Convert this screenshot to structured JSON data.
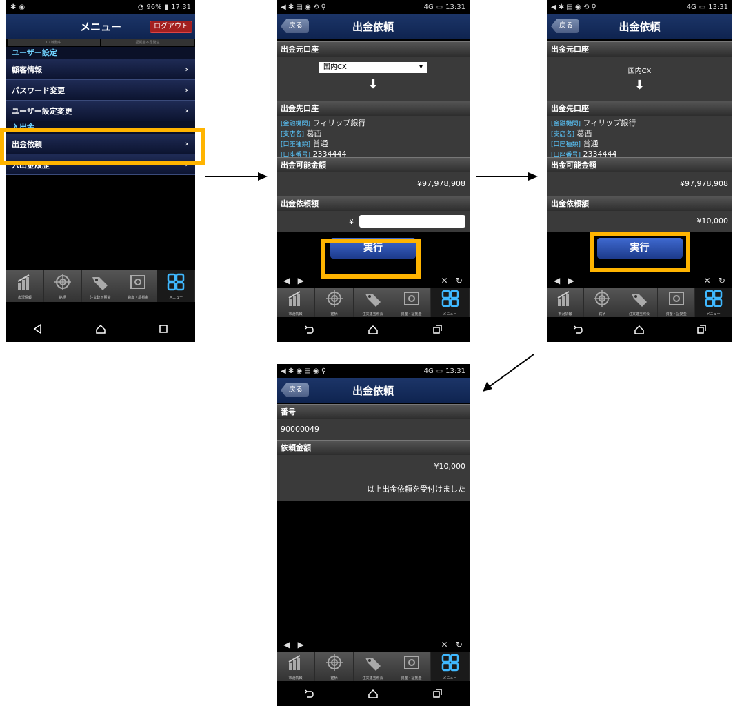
{
  "status1": {
    "battery": "96%",
    "time": "17:31"
  },
  "status2": {
    "time": "13:31",
    "signal": "4G"
  },
  "menu_screen": {
    "title": "メニュー",
    "logout": "ログアウト",
    "tabs": [
      "CX稼動中",
      "証拠金不足発生"
    ],
    "category_user": "ユーザー設定",
    "items": [
      "顧客情報",
      "パスワード変更",
      "ユーザー設定変更"
    ],
    "category_money": "入出金",
    "money_items": [
      "出金依頼",
      "入出金履歴"
    ]
  },
  "withdraw_screen": {
    "back": "戻る",
    "title": "出金依頼",
    "source_head": "出金元口座",
    "source_value": "国内CX",
    "dest_head": "出金先口座",
    "dest": [
      {
        "label": "[金融機関]",
        "value": "フィリップ銀行"
      },
      {
        "label": "[支店名]",
        "value": "葛西"
      },
      {
        "label": "[口座種類]",
        "value": "普通"
      },
      {
        "label": "[口座番号]",
        "value": "2334444"
      }
    ],
    "available_head": "出金可能金額",
    "available_value": "¥97,978,908",
    "request_head": "出金依頼額",
    "yen_prefix": "¥",
    "request_value": "¥10,000",
    "execute": "実行"
  },
  "result_screen": {
    "number_head": "番号",
    "number_value": "90000049",
    "amount_head": "依頼金額",
    "amount_value": "¥10,000",
    "message": "以上出金依頼を受付けました"
  },
  "bottom_nav": [
    "市況情報",
    "銘柄",
    "注文建玉照会",
    "資産・証拠金",
    "メニュー"
  ],
  "colors": {
    "highlight": "#ffb400",
    "header": "#1c3568",
    "execute": "#2a4da8"
  }
}
